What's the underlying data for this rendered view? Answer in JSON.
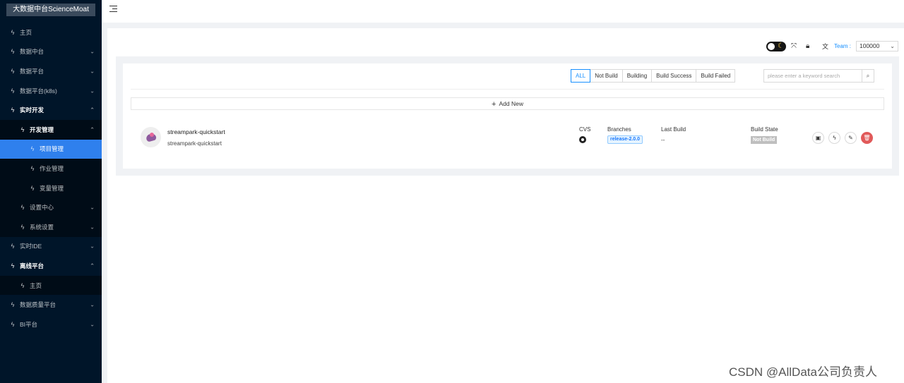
{
  "sidebar": {
    "logo": "大数据中台ScienceMoat",
    "items": [
      {
        "label": "主页",
        "level": 1,
        "arrow": ""
      },
      {
        "label": "数据中台",
        "level": 1,
        "arrow": "⌄"
      },
      {
        "label": "数据平台",
        "level": 1,
        "arrow": "⌄"
      },
      {
        "label": "数据平台(k8s)",
        "level": 1,
        "arrow": "⌄"
      },
      {
        "label": "实时开发",
        "level": 1,
        "arrow": "⌃"
      },
      {
        "label": "开发管理",
        "level": 2,
        "arrow": "⌃"
      },
      {
        "label": "项目管理",
        "level": 3,
        "arrow": ""
      },
      {
        "label": "作业管理",
        "level": 3,
        "arrow": ""
      },
      {
        "label": "变量管理",
        "level": 3,
        "arrow": ""
      },
      {
        "label": "设置中心",
        "level": 2,
        "arrow": "⌄"
      },
      {
        "label": "系统设置",
        "level": 2,
        "arrow": "⌄"
      },
      {
        "label": "实时IDE",
        "level": 1,
        "arrow": "⌄"
      },
      {
        "label": "离线平台",
        "level": 1,
        "arrow": "⌃"
      },
      {
        "label": "主页",
        "level": 2,
        "arrow": ""
      },
      {
        "label": "数据质量平台",
        "level": 1,
        "arrow": "⌄"
      },
      {
        "label": "BI平台",
        "level": 1,
        "arrow": "⌄"
      }
    ]
  },
  "toolbar": {
    "team_label": "Team :",
    "team_value": "100000"
  },
  "filters": [
    "ALL",
    "Not Build",
    "Building",
    "Build Success",
    "Build Failed"
  ],
  "search": {
    "placeholder": "please enter a keyword search"
  },
  "add_new_label": "Add New",
  "project": {
    "name": "streampark-quickstart",
    "description": "streampark-quickstart",
    "cvs_header": "CVS",
    "branches_header": "Branches",
    "branch": "release-2.0.0",
    "last_build_header": "Last Build",
    "last_build": "--",
    "build_state_header": "Build State",
    "build_state": "Not Build"
  },
  "watermark": "CSDN @AllData公司负责人",
  "colors": {
    "sidebar_bg": "#001529",
    "active": "#2f80ed",
    "accent": "#1890ff",
    "delete": "#e15a5a"
  }
}
